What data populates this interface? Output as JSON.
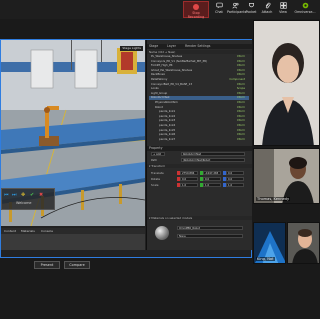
{
  "toolbar": {
    "record_label": "Stop Recording",
    "items": [
      {
        "label": "Chat",
        "icon": "chat-icon"
      },
      {
        "label": "Participants",
        "icon": "people-icon"
      },
      {
        "label": "Pocket",
        "icon": "pocket-icon"
      },
      {
        "label": "Attach",
        "icon": "attach-icon"
      },
      {
        "label": "View",
        "icon": "view-icon"
      },
      {
        "label": "Omniverse...",
        "icon": "omniverse-icon"
      }
    ]
  },
  "viewport": {
    "stage_lights_label": "Stage Lights",
    "overlay_label": "Welcome"
  },
  "panel": {
    "tabs": [
      "Stage",
      "Layer",
      "Render Settings"
    ],
    "tree_header": "Name (Old → New)",
    "tree_rows": [
      {
        "label": "PL_Warehouse_Shelves",
        "vis": "Xform"
      },
      {
        "label": "Conveyors_PR_V1 (SubBarBarSet_MH_PR)",
        "vis": "Xform"
      },
      {
        "label": "Forklift_High_PR",
        "vis": "Xform"
      },
      {
        "label": "Ghost_Pal_Warehouse_Shelves",
        "vis": "Xform"
      },
      {
        "label": "RackBinsA",
        "vis": "Xform"
      },
      {
        "label": "PalletSkinny",
        "vis": "Component"
      },
      {
        "label": "ConveyorBelt_PR_V4_BASE_13",
        "vis": "Xform"
      },
      {
        "label": "Looks",
        "vis": "Scope"
      },
      {
        "label": "Light_Group",
        "vis": "Xform"
      },
      {
        "label": "RobotArmTest",
        "vis": "Xform"
      },
      {
        "label": "PhysicsRobotSim",
        "vis": "Xform"
      },
      {
        "label": "Robot",
        "vis": "Xform"
      },
      {
        "label": "panda_link1",
        "vis": "Xform"
      },
      {
        "label": "panda_link2",
        "vis": "Xform"
      },
      {
        "label": "panda_link3",
        "vis": "Xform"
      },
      {
        "label": "panda_link4",
        "vis": "Xform"
      },
      {
        "label": "panda_link5",
        "vis": "Xform"
      },
      {
        "label": "panda_link6",
        "vis": "Xform"
      },
      {
        "label": "panda_link7",
        "vis": "Xform"
      }
    ],
    "property_header": "Property",
    "add_label": "+ Add",
    "path_label": "Path",
    "path_value": "/RobotArmTest/Robot",
    "name_label": "Name",
    "name_value": "RobotArmTest",
    "transform_header": "▾ Transform",
    "translate_label": "Translate",
    "rotate_label": "Rotate",
    "scale_label": "Scale",
    "translate_vals": [
      "2750.884",
      "-1047.265",
      "0.0"
    ],
    "rotate_vals": [
      "0.0",
      "0.0",
      "0.0"
    ],
    "scale_vals": [
      "1.0",
      "1.0",
      "1.0"
    ],
    "material_header": "▾ Materials on selected models",
    "material_name": "OmniPBR_Robot",
    "material_sub": "None"
  },
  "bottom_tabs": [
    "Content",
    "Materials",
    "Console"
  ],
  "buttons": {
    "present": "Present",
    "compare": "Compare"
  },
  "participants": [
    {
      "name": ""
    },
    {
      "name": "Thomas, Kennedy"
    },
    {
      "name": "King, Nat"
    },
    {
      "name": ""
    }
  ],
  "colors": {
    "accent_blue": "#2f7de0",
    "record_red": "#c0392b",
    "selection": "#3a5f8a"
  }
}
